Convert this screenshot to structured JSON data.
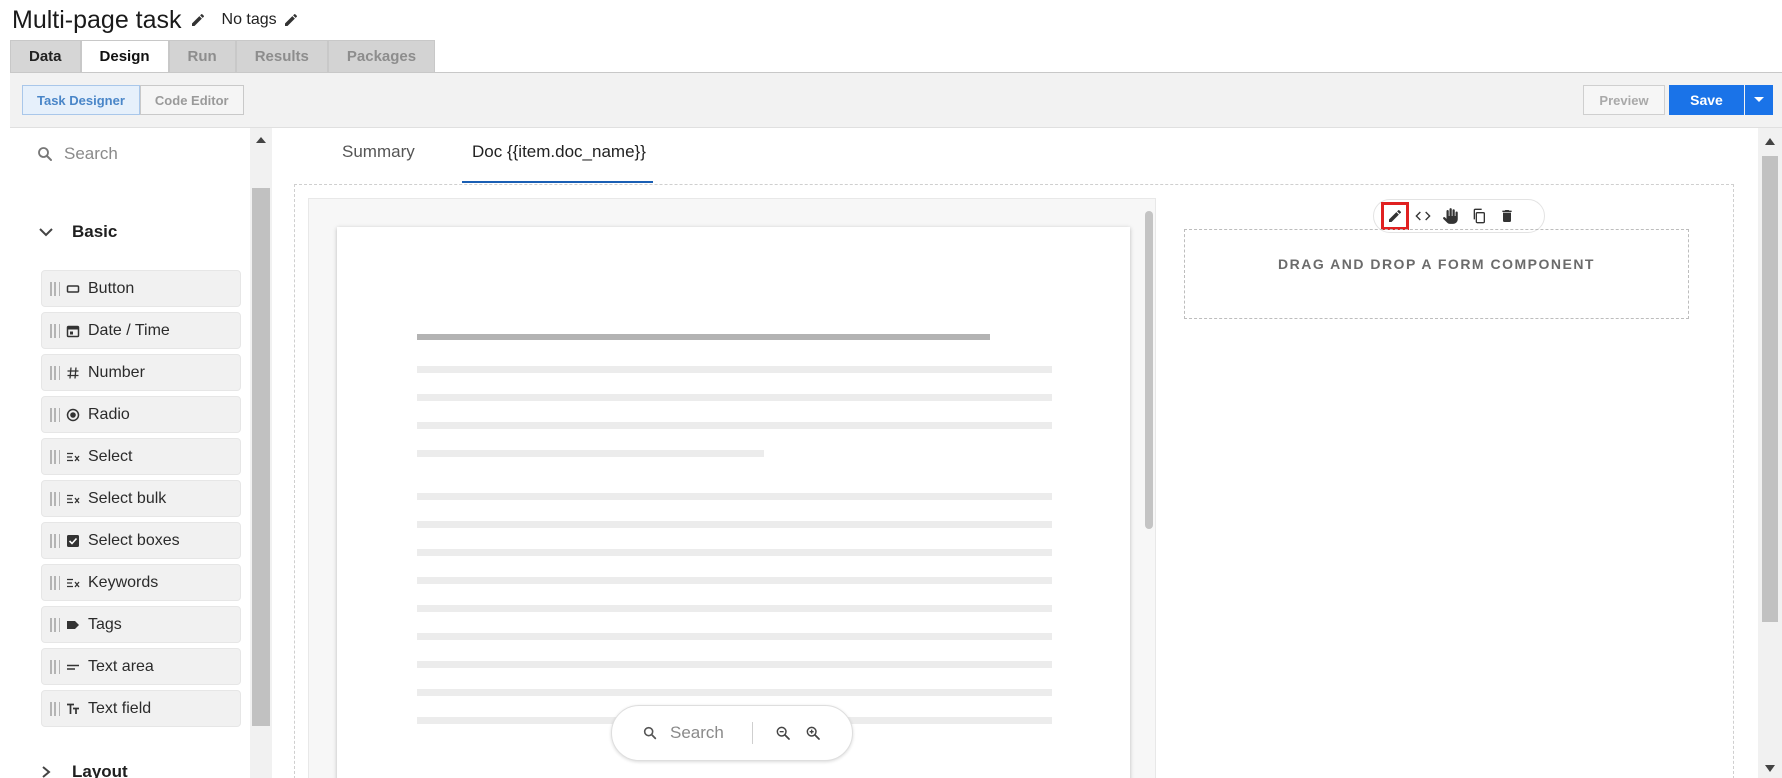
{
  "header": {
    "title": "Multi-page task",
    "tags_label": "No tags"
  },
  "main_tabs": [
    {
      "label": "Data",
      "state": "normal"
    },
    {
      "label": "Design",
      "state": "active"
    },
    {
      "label": "Run",
      "state": "disabled"
    },
    {
      "label": "Results",
      "state": "disabled"
    },
    {
      "label": "Packages",
      "state": "disabled"
    }
  ],
  "toolbar": {
    "task_designer_label": "Task Designer",
    "code_editor_label": "Code Editor",
    "preview_label": "Preview",
    "save_label": "Save"
  },
  "palette": {
    "search_placeholder": "Search",
    "basic_group_label": "Basic",
    "components": [
      {
        "label": "Button",
        "icon": "button-icon"
      },
      {
        "label": "Date / Time",
        "icon": "calendar-icon"
      },
      {
        "label": "Number",
        "icon": "hash-icon"
      },
      {
        "label": "Radio",
        "icon": "radio-icon"
      },
      {
        "label": "Select",
        "icon": "select-icon"
      },
      {
        "label": "Select bulk",
        "icon": "select-icon"
      },
      {
        "label": "Select boxes",
        "icon": "checkbox-icon"
      },
      {
        "label": "Keywords",
        "icon": "select-icon"
      },
      {
        "label": "Tags",
        "icon": "tag-icon"
      },
      {
        "label": "Text area",
        "icon": "text-area-icon"
      },
      {
        "label": "Text field",
        "icon": "text-field-icon"
      }
    ],
    "layout_group_label": "Layout"
  },
  "canvas": {
    "tabs": [
      {
        "label": "Summary"
      },
      {
        "label": "Doc {{item.doc_name}}"
      }
    ],
    "zoom_search_placeholder": "Search",
    "drop_hint": "DRAG AND DROP A FORM COMPONENT",
    "component_toolbar": [
      "edit-icon",
      "code-icon",
      "drag-hand-icon",
      "copy-icon",
      "delete-icon"
    ]
  },
  "colors": {
    "accent": "#1a73e8",
    "highlight": "#e02020"
  }
}
